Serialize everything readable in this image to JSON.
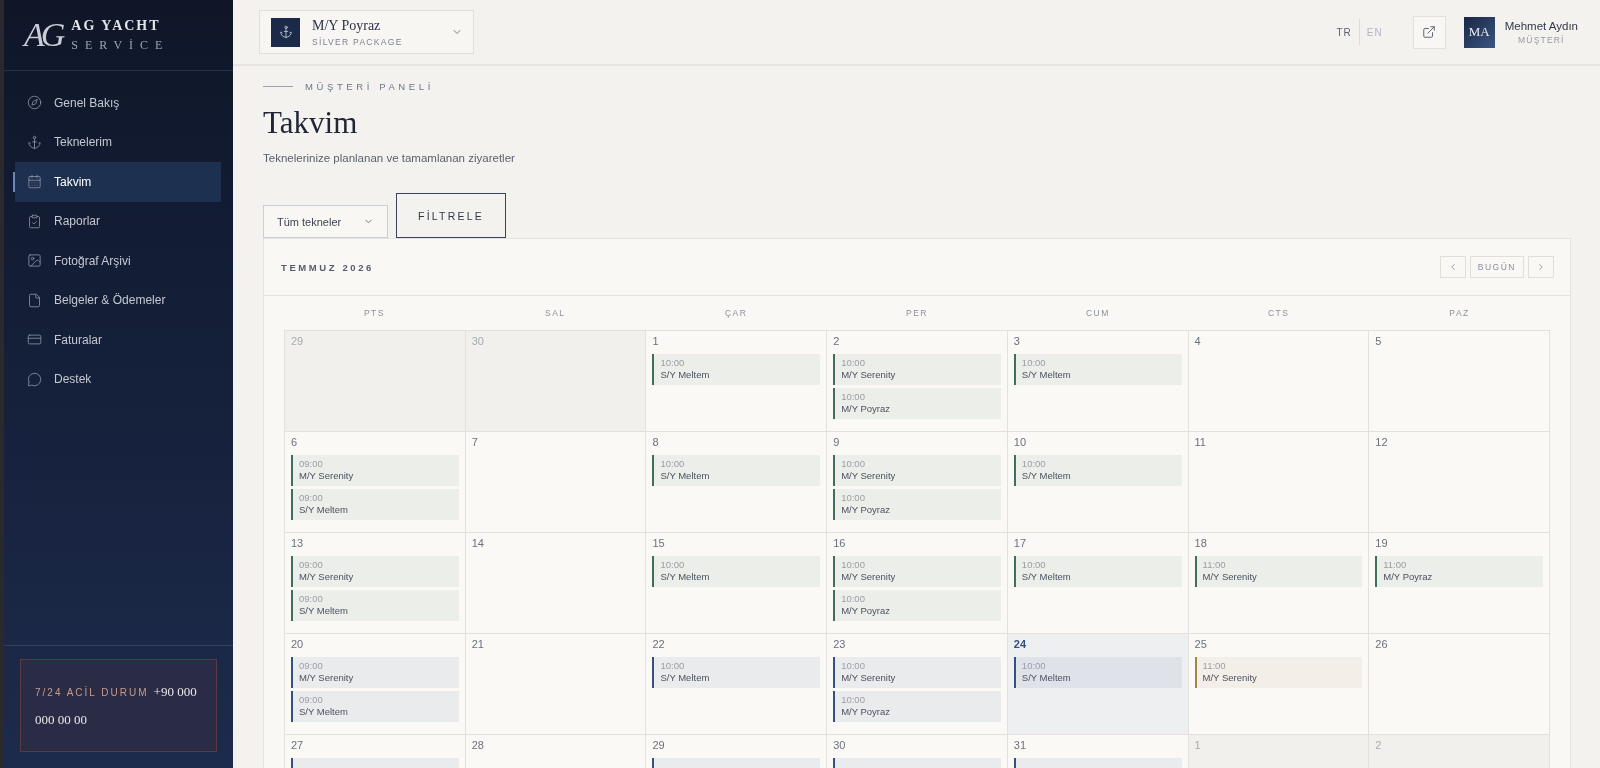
{
  "brand": {
    "monogram": "AG",
    "name": "AG YACHT",
    "tagline": "SERVİCE"
  },
  "sidebar": {
    "items": [
      {
        "label": "Genel Bakış",
        "selected": false
      },
      {
        "label": "Teknelerim",
        "selected": false
      },
      {
        "label": "Takvim",
        "selected": true
      },
      {
        "label": "Raporlar",
        "selected": false
      },
      {
        "label": "Fotoğraf Arşivi",
        "selected": false
      },
      {
        "label": "Belgeler & Ödemeler",
        "selected": false
      },
      {
        "label": "Faturalar",
        "selected": false
      },
      {
        "label": "Destek",
        "selected": false
      }
    ],
    "emergency": {
      "label": "7/24 ACİL DURUM",
      "phone": "+90 000 000 00 00"
    }
  },
  "topbar": {
    "vessel": {
      "name": "M/Y Poyraz",
      "package": "SİLVER PACKAGE"
    },
    "languages": [
      {
        "label": "TR",
        "selected": true
      },
      {
        "label": "EN",
        "selected": false
      }
    ],
    "user": {
      "initials": "MA",
      "name": "Mehmet Aydın",
      "role": "MÜŞTERİ"
    }
  },
  "page": {
    "eyebrow": "MÜŞTERİ PANELİ",
    "title": "Takvim",
    "subtitle": "Teknelerinize planlanan ve tamamlanan ziyaretler"
  },
  "filter": {
    "select": "Tüm tekneler",
    "button": "FİLTRELE"
  },
  "calendar": {
    "month": "TEMMUZ 2026",
    "today_button": "BUGÜN",
    "weekdays": [
      "PTS",
      "SAL",
      "ÇAR",
      "PER",
      "CUM",
      "CTS",
      "PAZ"
    ],
    "weeks": [
      [
        {
          "day": "29",
          "outside": true,
          "today": false
        },
        {
          "day": "30",
          "outside": true,
          "today": false
        },
        {
          "day": "1",
          "outside": false,
          "today": false,
          "events": [
            {
              "time": "10:00",
              "vessel": "S/Y Meltem",
              "color": "#3f6e5c"
            }
          ]
        },
        {
          "day": "2",
          "outside": false,
          "today": false,
          "events": [
            {
              "time": "10:00",
              "vessel": "M/Y Serenity",
              "color": "#3f6e5c"
            },
            {
              "time": "10:00",
              "vessel": "M/Y Poyraz",
              "color": "#3f6e5c"
            }
          ]
        },
        {
          "day": "3",
          "outside": false,
          "today": false,
          "events": [
            {
              "time": "10:00",
              "vessel": "S/Y Meltem",
              "color": "#3f6e5c"
            }
          ]
        },
        {
          "day": "4",
          "outside": false,
          "today": false
        },
        {
          "day": "5",
          "outside": false,
          "today": false
        }
      ],
      [
        {
          "day": "6",
          "outside": false,
          "today": false,
          "events": [
            {
              "time": "09:00",
              "vessel": "M/Y Serenity",
              "color": "#3f6e5c"
            },
            {
              "time": "09:00",
              "vessel": "S/Y Meltem",
              "color": "#3f6e5c"
            }
          ]
        },
        {
          "day": "7",
          "outside": false,
          "today": false
        },
        {
          "day": "8",
          "outside": false,
          "today": false,
          "events": [
            {
              "time": "10:00",
              "vessel": "S/Y Meltem",
              "color": "#3f6e5c"
            }
          ]
        },
        {
          "day": "9",
          "outside": false,
          "today": false,
          "events": [
            {
              "time": "10:00",
              "vessel": "M/Y Serenity",
              "color": "#3f6e5c"
            },
            {
              "time": "10:00",
              "vessel": "M/Y Poyraz",
              "color": "#3f6e5c"
            }
          ]
        },
        {
          "day": "10",
          "outside": false,
          "today": false,
          "events": [
            {
              "time": "10:00",
              "vessel": "S/Y Meltem",
              "color": "#3f6e5c"
            }
          ]
        },
        {
          "day": "11",
          "outside": false,
          "today": false
        },
        {
          "day": "12",
          "outside": false,
          "today": false
        }
      ],
      [
        {
          "day": "13",
          "outside": false,
          "today": false,
          "events": [
            {
              "time": "09:00",
              "vessel": "M/Y Serenity",
              "color": "#3f6e5c"
            },
            {
              "time": "09:00",
              "vessel": "S/Y Meltem",
              "color": "#3f6e5c"
            }
          ]
        },
        {
          "day": "14",
          "outside": false,
          "today": false
        },
        {
          "day": "15",
          "outside": false,
          "today": false,
          "events": [
            {
              "time": "10:00",
              "vessel": "S/Y Meltem",
              "color": "#3f6e5c"
            }
          ]
        },
        {
          "day": "16",
          "outside": false,
          "today": false,
          "events": [
            {
              "time": "10:00",
              "vessel": "M/Y Serenity",
              "color": "#3f6e5c"
            },
            {
              "time": "10:00",
              "vessel": "M/Y Poyraz",
              "color": "#3f6e5c"
            }
          ]
        },
        {
          "day": "17",
          "outside": false,
          "today": false,
          "events": [
            {
              "time": "10:00",
              "vessel": "S/Y Meltem",
              "color": "#3f6e5c"
            }
          ]
        },
        {
          "day": "18",
          "outside": false,
          "today": false,
          "events": [
            {
              "time": "11:00",
              "vessel": "M/Y Serenity",
              "color": "#3f6e5c"
            }
          ]
        },
        {
          "day": "19",
          "outside": false,
          "today": false,
          "events": [
            {
              "time": "11:00",
              "vessel": "M/Y Poyraz",
              "color": "#3f6e5c"
            }
          ]
        }
      ],
      [
        {
          "day": "20",
          "outside": false,
          "today": false,
          "events": [
            {
              "time": "09:00",
              "vessel": "M/Y Serenity",
              "color": "#34507f"
            },
            {
              "time": "09:00",
              "vessel": "S/Y Meltem",
              "color": "#34507f"
            }
          ]
        },
        {
          "day": "21",
          "outside": false,
          "today": false
        },
        {
          "day": "22",
          "outside": false,
          "today": false,
          "events": [
            {
              "time": "10:00",
              "vessel": "S/Y Meltem",
              "color": "#34507f"
            }
          ]
        },
        {
          "day": "23",
          "outside": false,
          "today": false,
          "events": [
            {
              "time": "10:00",
              "vessel": "M/Y Serenity",
              "color": "#34507f"
            },
            {
              "time": "10:00",
              "vessel": "M/Y Poyraz",
              "color": "#34507f"
            }
          ]
        },
        {
          "day": "24",
          "outside": false,
          "today": true,
          "events": [
            {
              "time": "10:00",
              "vessel": "S/Y Meltem",
              "color": "#34507f"
            }
          ]
        },
        {
          "day": "25",
          "outside": false,
          "today": false,
          "events": [
            {
              "time": "11:00",
              "vessel": "M/Y Serenity",
              "color": "#a08448"
            }
          ]
        },
        {
          "day": "26",
          "outside": false,
          "today": false
        }
      ],
      [
        {
          "day": "27",
          "outside": false,
          "today": false,
          "events": [
            {
              "color": "#34507f"
            }
          ]
        },
        {
          "day": "28",
          "outside": false,
          "today": false
        },
        {
          "day": "29",
          "outside": false,
          "today": false,
          "events": [
            {
              "color": "#34507f"
            }
          ]
        },
        {
          "day": "30",
          "outside": false,
          "today": false,
          "events": [
            {
              "color": "#34507f"
            }
          ]
        },
        {
          "day": "31",
          "outside": false,
          "today": false,
          "events": [
            {
              "color": "#34507f"
            }
          ]
        },
        {
          "day": "1",
          "outside": true,
          "today": false
        },
        {
          "day": "2",
          "outside": true,
          "today": false
        }
      ]
    ]
  }
}
